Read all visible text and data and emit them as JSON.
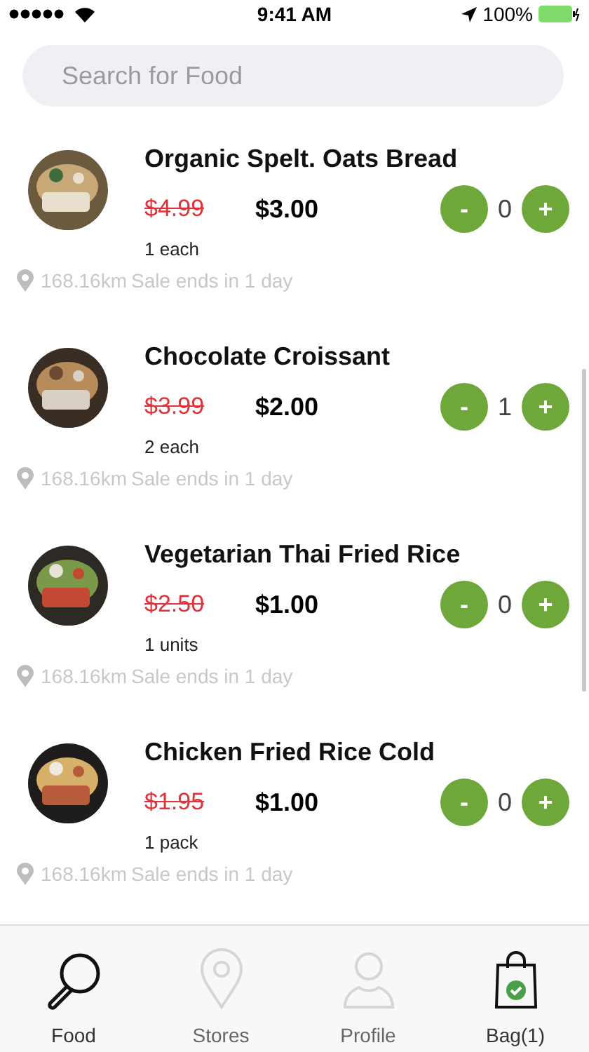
{
  "status_bar": {
    "time": "9:41 AM",
    "battery": "100%"
  },
  "search": {
    "placeholder": "Search for Food"
  },
  "items": [
    {
      "name": "Organic Spelt. Oats Bread",
      "old_price": "$4.99",
      "price": "$3.00",
      "unit": "1 each",
      "quantity": "0",
      "distance": "168.16km",
      "sale": "Sale ends in 1 day",
      "decrement": "-",
      "increment": "+"
    },
    {
      "name": "Chocolate Croissant",
      "old_price": "$3.99",
      "price": "$2.00",
      "unit": "2 each",
      "quantity": "1",
      "distance": "168.16km",
      "sale": "Sale ends in 1 day",
      "decrement": "-",
      "increment": "+"
    },
    {
      "name": "Vegetarian Thai Fried Rice",
      "old_price": "$2.50",
      "price": "$1.00",
      "unit": "1 units",
      "quantity": "0",
      "distance": "168.16km",
      "sale": "Sale ends in 1 day",
      "decrement": "-",
      "increment": "+"
    },
    {
      "name": "Chicken Fried Rice Cold",
      "old_price": "$1.95",
      "price": "$1.00",
      "unit": "1 pack",
      "quantity": "0",
      "distance": "168.16km",
      "sale": "Sale ends in 1 day",
      "decrement": "-",
      "increment": "+"
    }
  ],
  "tabs": [
    {
      "label": "Food",
      "kind": "search",
      "dimmed": false
    },
    {
      "label": "Stores",
      "kind": "pin",
      "dimmed": true
    },
    {
      "label": "Profile",
      "kind": "person",
      "dimmed": true
    },
    {
      "label": "Bag(1)",
      "kind": "bag",
      "dimmed": false
    }
  ]
}
